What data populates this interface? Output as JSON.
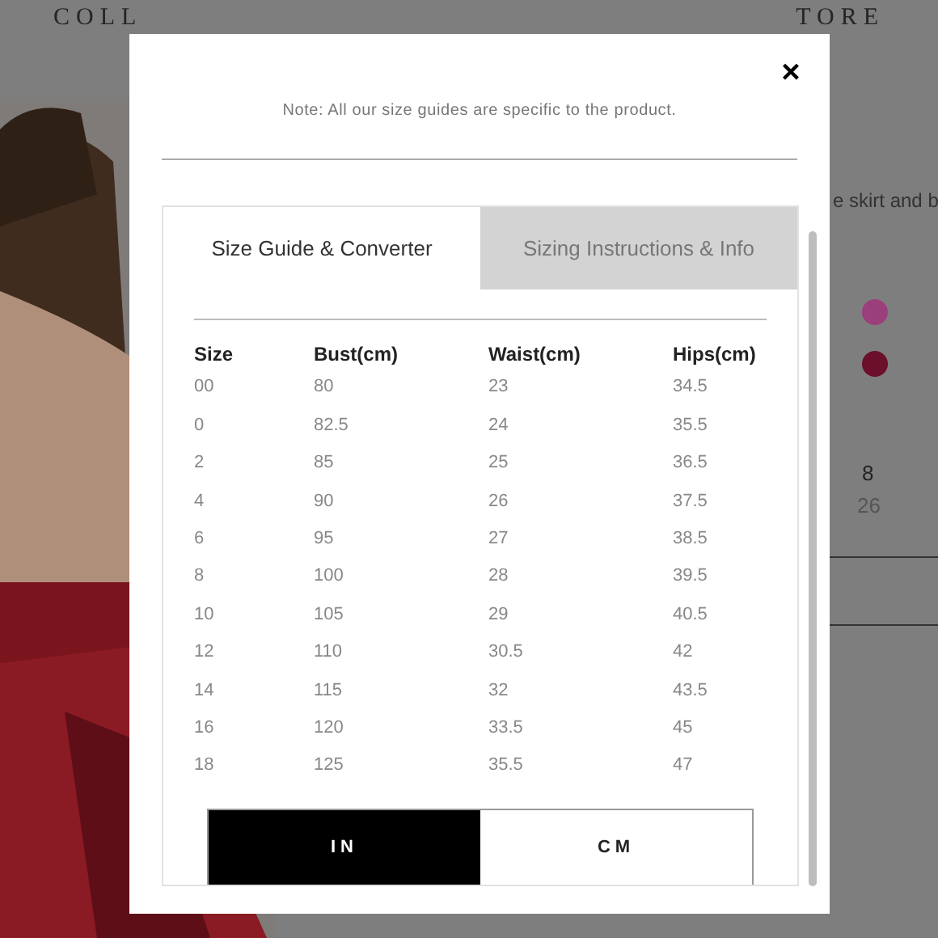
{
  "background_page": {
    "nav_left": "COLL",
    "nav_right": "TORE",
    "description": "e skirt and b",
    "swatches": [
      {
        "color": "#9b3f7c"
      },
      {
        "color": "#6b0f2b"
      }
    ],
    "size_label": "8",
    "size_value": "26"
  },
  "modal": {
    "close": "×",
    "note": "Note: All our size guides are specific to the product.",
    "tabs": [
      {
        "label": "Size Guide & Converter",
        "selected": true
      },
      {
        "label": "Sizing Instructions & Info",
        "selected": false
      }
    ],
    "columns": [
      "Size",
      "Bust(cm)",
      "Waist(cm)",
      "Hips(cm)"
    ],
    "rows": [
      [
        "00",
        "80",
        "23",
        "34.5"
      ],
      [
        "0",
        "82.5",
        "24",
        "35.5"
      ],
      [
        "2",
        "85",
        "25",
        "36.5"
      ],
      [
        "4",
        "90",
        "26",
        "37.5"
      ],
      [
        "6",
        "95",
        "27",
        "38.5"
      ],
      [
        "8",
        "100",
        "28",
        "39.5"
      ],
      [
        "10",
        "105",
        "29",
        "40.5"
      ],
      [
        "12",
        "110",
        "30.5",
        "42"
      ],
      [
        "14",
        "115",
        "32",
        "43.5"
      ],
      [
        "16",
        "120",
        "33.5",
        "45"
      ],
      [
        "18",
        "125",
        "35.5",
        "47"
      ]
    ],
    "unit_toggle": [
      {
        "label": "IN",
        "selected": true
      },
      {
        "label": "CM",
        "selected": false
      }
    ]
  }
}
